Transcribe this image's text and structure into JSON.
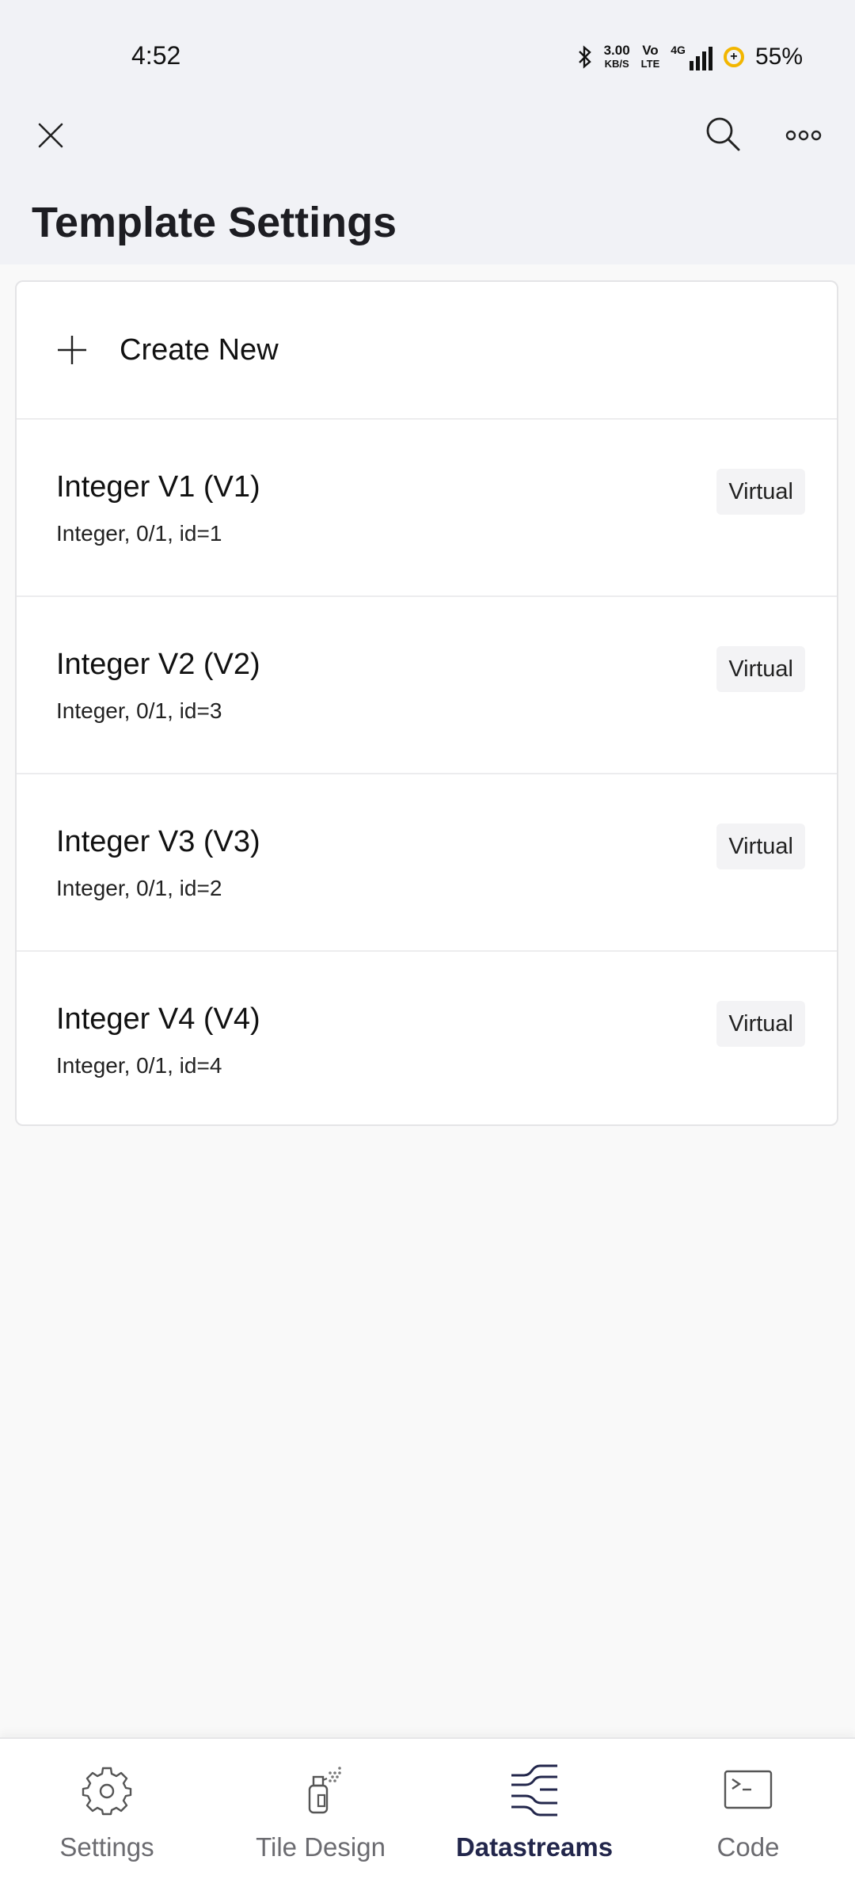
{
  "status_bar": {
    "time": "4:52",
    "net_speed_value": "3.00",
    "net_speed_unit": "KB/S",
    "volte_top": "Vo",
    "volte_bottom": "LTE",
    "network": "4G",
    "battery_icon_glyph": "+",
    "battery": "55%",
    "accent_color": "#f2b600"
  },
  "toolbar": {
    "close_icon": "close-icon",
    "search_icon": "search-icon",
    "more_icon": "more-horizontal-icon"
  },
  "page": {
    "title": "Template Settings"
  },
  "create_new": {
    "label": "Create New",
    "icon": "plus-icon"
  },
  "datastreams": [
    {
      "name": "Integer V1 (V1)",
      "description": "Integer, 0/1, id=1",
      "badge": "Virtual"
    },
    {
      "name": "Integer V2 (V2)",
      "description": "Integer, 0/1, id=3",
      "badge": "Virtual"
    },
    {
      "name": "Integer V3 (V3)",
      "description": "Integer, 0/1, id=2",
      "badge": "Virtual"
    },
    {
      "name": "Integer V4 (V4)",
      "description": "Integer, 0/1, id=4",
      "badge": "Virtual"
    }
  ],
  "bottom_nav": {
    "active_color": "#22264b",
    "items": [
      {
        "label": "Settings",
        "icon": "gear-icon",
        "active": false
      },
      {
        "label": "Tile Design",
        "icon": "spray-can-icon",
        "active": false
      },
      {
        "label": "Datastreams",
        "icon": "datastreams-icon",
        "active": true
      },
      {
        "label": "Code",
        "icon": "terminal-icon",
        "active": false
      }
    ]
  }
}
